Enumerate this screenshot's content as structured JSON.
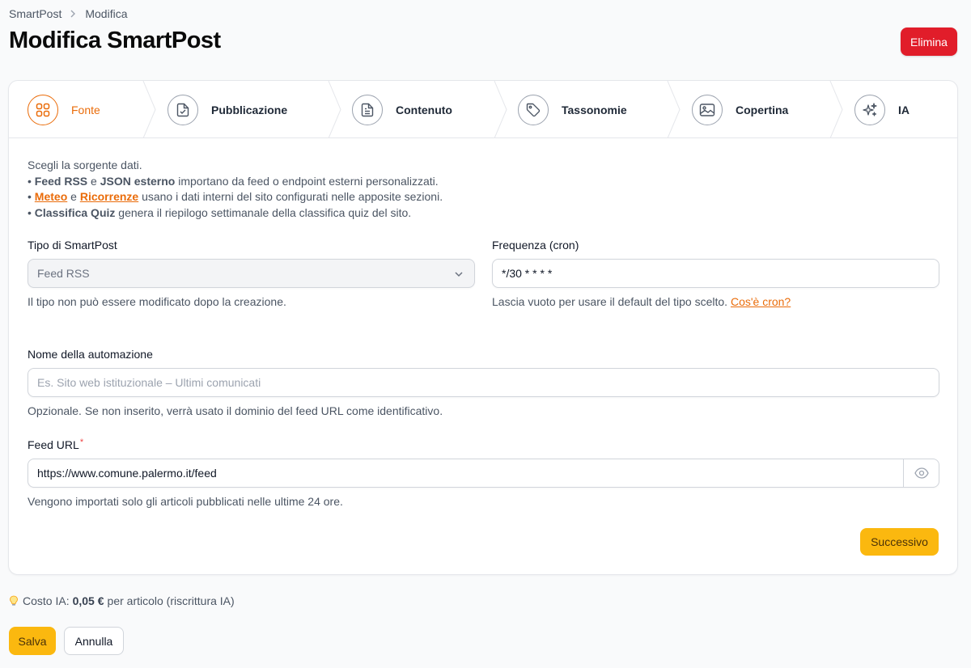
{
  "breadcrumb": {
    "root": "SmartPost",
    "current": "Modifica"
  },
  "page": {
    "title": "Modifica SmartPost",
    "delete_label": "Elimina"
  },
  "steps": [
    {
      "label": "Fonte",
      "icon": "grid-icon",
      "active": true
    },
    {
      "label": "Pubblicazione",
      "icon": "file-check-icon"
    },
    {
      "label": "Contenuto",
      "icon": "file-text-icon"
    },
    {
      "label": "Tassonomie",
      "icon": "tag-icon"
    },
    {
      "label": "Copertina",
      "icon": "image-icon"
    },
    {
      "label": "IA",
      "icon": "sparkles-icon"
    }
  ],
  "intro": {
    "line1": "Scegli la sorgente dati.",
    "line2": {
      "bullet": "•",
      "a": "Feed RSS",
      "and": "e",
      "b": "JSON esterno",
      "rest": "importano da feed o endpoint esterni personalizzati."
    },
    "line3": {
      "bullet": "•",
      "a": "Meteo",
      "and": "e",
      "b": "Ricorrenze",
      "rest": "usano i dati interni del sito configurati nelle apposite sezioni."
    },
    "line4": {
      "bullet": "•",
      "a": "Classifica Quiz",
      "rest": "genera il riepilogo settimanale della classifica quiz del sito."
    }
  },
  "type_field": {
    "label": "Tipo di SmartPost",
    "value": "Feed RSS",
    "hint": "Il tipo non può essere modificato dopo la creazione."
  },
  "cron_field": {
    "label": "Frequenza (cron)",
    "value": "*/30 * * * *",
    "hint": "Lascia vuoto per usare il default del tipo scelto.",
    "hint_link": "Cos'è cron?"
  },
  "name_field": {
    "label": "Nome della automazione",
    "placeholder": "Es. Sito web istituzionale – Ultimi comunicati",
    "hint": "Opzionale. Se non inserito, verrà usato il dominio del feed URL come identificativo."
  },
  "url_field": {
    "label": "Feed URL",
    "required": "*",
    "value": "https://www.comune.palermo.it/feed",
    "hint": "Vengono importati solo gli articoli pubblicati nelle ultime 24 ore."
  },
  "buttons": {
    "next": "Successivo",
    "save": "Salva",
    "cancel": "Annulla"
  },
  "cost": {
    "prefix": "Costo IA:",
    "amount": "0,05 €",
    "suffix": "per articolo (riscrittura IA)"
  },
  "colors": {
    "accent": "#ea6c0a",
    "danger": "#e11d2a",
    "primary": "#fbb80f"
  }
}
